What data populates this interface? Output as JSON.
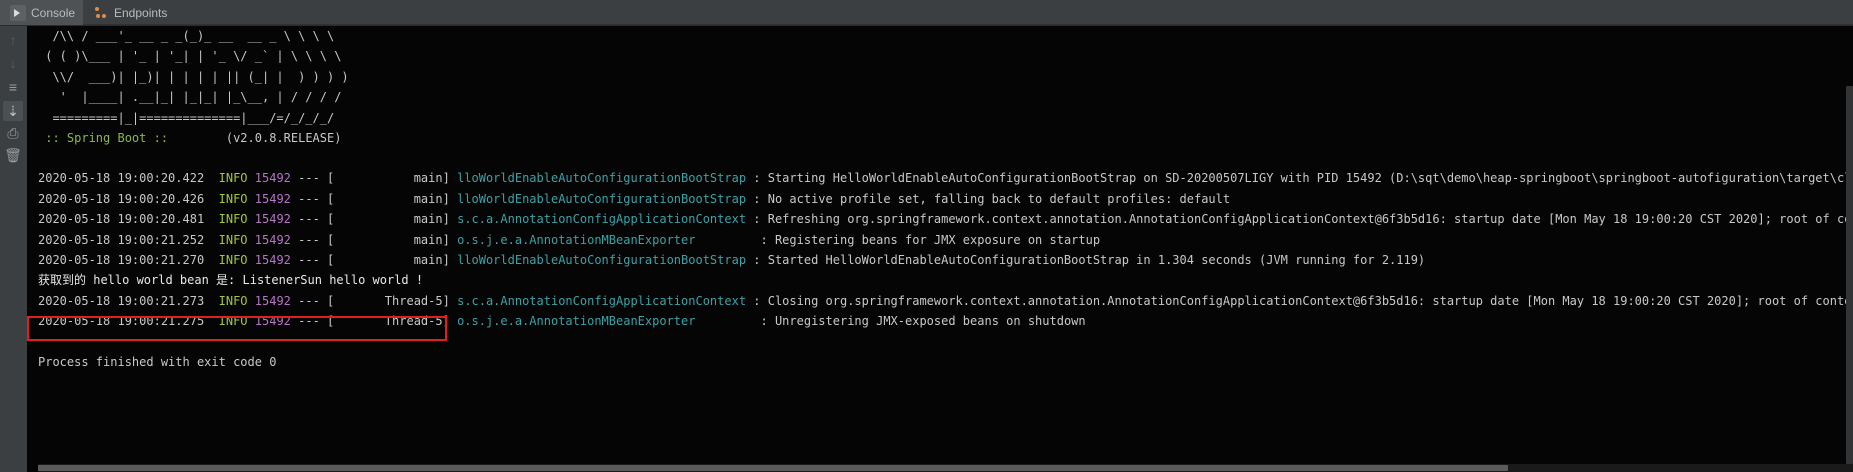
{
  "tabs": [
    {
      "label": "Console",
      "icon": "console-icon"
    },
    {
      "label": "Endpoints",
      "icon": "endpoints-icon"
    }
  ],
  "toolbar": [
    "arrow-up-icon",
    "arrow-down-icon",
    "soft-wrap-icon",
    "scroll-to-end-icon",
    "print-icon",
    "clear-all-icon"
  ],
  "colors": {
    "background": "#050505",
    "text": "#c8c8c8",
    "info_level": "#a4c639",
    "pid": "#b675c6",
    "logger": "#3da1a6",
    "spring_boot_label": "#8bb849",
    "highlight_border": "#e02020"
  },
  "console": {
    "banner": [
      "  /\\\\ / ___'_ __ _ _(_)_ __  __ _ \\ \\ \\ \\",
      " ( ( )\\___ | '_ | '_| | '_ \\/ _` | \\ \\ \\ \\",
      "  \\\\/  ___)| |_)| | | | | || (_| |  ) ) ) )",
      "   '  |____| .__|_| |_|_| |_\\__, | / / / /",
      "  =========|_|==============|___/=/_/_/_/"
    ],
    "spring_boot": {
      "label": " :: Spring Boot :: ",
      "version": "       (v2.0.8.RELEASE)"
    },
    "logs": [
      {
        "time": "2020-05-18 19:00:20.422",
        "level": "INFO",
        "pid": "15492",
        "sep": " --- [           main] ",
        "logger": "lloWorldEnableAutoConfigurationBootStrap",
        "message": " : Starting HelloWorldEnableAutoConfigurationBootStrap on SD-20200507LIGY with PID 15492 (D:\\sqt\\demo\\heap-springboot\\springboot-autofiguration\\target\\classes s"
      },
      {
        "time": "2020-05-18 19:00:20.426",
        "level": "INFO",
        "pid": "15492",
        "sep": " --- [           main] ",
        "logger": "lloWorldEnableAutoConfigurationBootStrap",
        "message": " : No active profile set, falling back to default profiles: default"
      },
      {
        "time": "2020-05-18 19:00:20.481",
        "level": "INFO",
        "pid": "15492",
        "sep": " --- [           main] ",
        "logger": "s.c.a.AnnotationConfigApplicationContext",
        "message": " : Refreshing org.springframework.context.annotation.AnnotationConfigApplicationContext@6f3b5d16: startup date [Mon May 18 19:00:20 CST 2020]; root of context h"
      },
      {
        "time": "2020-05-18 19:00:21.252",
        "level": "INFO",
        "pid": "15492",
        "sep": " --- [           main] ",
        "logger": "o.s.j.e.a.AnnotationMBeanExporter        ",
        "message": " : Registering beans for JMX exposure on startup"
      },
      {
        "time": "2020-05-18 19:00:21.270",
        "level": "INFO",
        "pid": "15492",
        "sep": " --- [           main] ",
        "logger": "lloWorldEnableAutoConfigurationBootStrap",
        "message": " : Started HelloWorldEnableAutoConfigurationBootStrap in 1.304 seconds (JVM running for 2.119)"
      },
      {
        "time": "2020-05-18 19:00:21.273",
        "level": "INFO",
        "pid": "15492",
        "sep": " --- [       Thread-5] ",
        "logger": "s.c.a.AnnotationConfigApplicationContext",
        "message": " : Closing org.springframework.context.annotation.AnnotationConfigApplicationContext@6f3b5d16: startup date [Mon May 18 19:00:20 CST 2020]; root of context hier"
      },
      {
        "time": "2020-05-18 19:00:21.275",
        "level": "INFO",
        "pid": "15492",
        "sep": " --- [       Thread-5] ",
        "logger": "o.s.j.e.a.AnnotationMBeanExporter        ",
        "message": " : Unregistering JMX-exposed beans on shutdown"
      }
    ],
    "output_line": "获取到的 hello world bean 是: ListenerSun hello world !",
    "exit_line": "Process finished with exit code 0"
  }
}
